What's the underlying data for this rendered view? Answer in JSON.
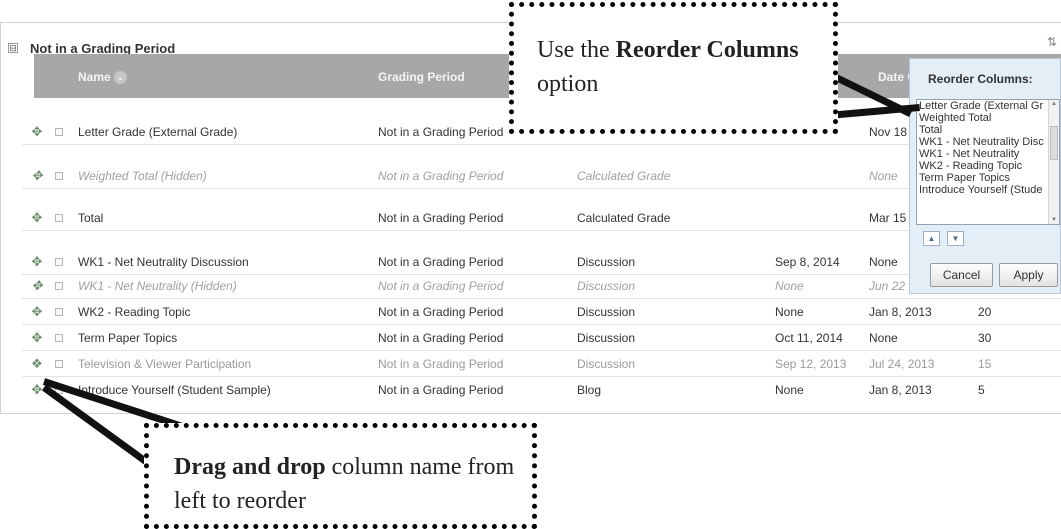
{
  "section": {
    "title": "Not in a Grading Period",
    "collapse_symbol": "⊟",
    "corner_icon": "⇅"
  },
  "headers": {
    "name": "Name",
    "sort_glyph": "⌄",
    "grading_period": "Grading Period",
    "date": "Date C"
  },
  "rows": [
    {
      "name": "Letter Grade (External Grade)",
      "period": "Not in a Grading Period",
      "type": "",
      "due": "",
      "modified": "Nov 18",
      "points": "",
      "style": "normal"
    },
    {
      "name": "Weighted Total (Hidden)",
      "period": "Not in a Grading Period",
      "type": "Calculated Grade",
      "due": "",
      "modified": "None",
      "points": "",
      "style": "hidden"
    },
    {
      "name": "Total",
      "period": "Not in a Grading Period",
      "type": "Calculated Grade",
      "due": "",
      "modified": "Mar 15",
      "points": "",
      "style": "normal"
    },
    {
      "name": "WK1 - Net Neutrality Discussion",
      "period": "Not in a Grading Period",
      "type": "Discussion",
      "due": "Sep 8, 2014",
      "modified": "None",
      "points": "",
      "style": "normal"
    },
    {
      "name": "WK1 - Net Neutrality (Hidden)",
      "period": "Not in a Grading Period",
      "type": "Discussion",
      "due": "None",
      "modified": "Jun 22",
      "points": "",
      "style": "hidden"
    },
    {
      "name": "WK2 - Reading Topic",
      "period": "Not in a Grading Period",
      "type": "Discussion",
      "due": "None",
      "modified": "Jan 8, 2013",
      "points": "20",
      "style": "normal"
    },
    {
      "name": "Term Paper Topics",
      "period": "Not in a Grading Period",
      "type": "Discussion",
      "due": "Oct 11, 2014",
      "modified": "None",
      "points": "30",
      "style": "normal"
    },
    {
      "name": "Television & Viewer Participation",
      "period": "Not in a Grading Period",
      "type": "Discussion",
      "due": "Sep 12, 2013",
      "modified": "Jul 24, 2013",
      "points": "15",
      "style": "faded"
    },
    {
      "name": "Introduce Yourself (Student Sample)",
      "period": "Not in a Grading Period",
      "type": "Blog",
      "due": "None",
      "modified": "Jan 8, 2013",
      "points": "5",
      "style": "normal"
    }
  ],
  "reorder": {
    "title": "Reorder Columns:",
    "items": [
      "Letter Grade (External Gr",
      "Weighted Total",
      "Total",
      "WK1 - Net Neutrality Disc",
      "WK1 - Net Neutrality",
      "WK2 - Reading Topic",
      "Term Paper Topics",
      "Introduce Yourself (Stude"
    ],
    "up_glyph": "▲",
    "down_glyph": "▼",
    "cancel": "Cancel",
    "apply": "Apply"
  },
  "callouts": {
    "top": {
      "pre": "Use the ",
      "bold": "Reorder Columns",
      "post": " option"
    },
    "bottom": {
      "bold": "Drag and drop",
      "post": " column name from left to reorder"
    }
  },
  "icons": {
    "move": "move-arrows-icon",
    "checkbox": "checkbox-icon"
  },
  "colors": {
    "header_bar": "#a7a7a7",
    "reorder_panel": "#e4eef6"
  }
}
